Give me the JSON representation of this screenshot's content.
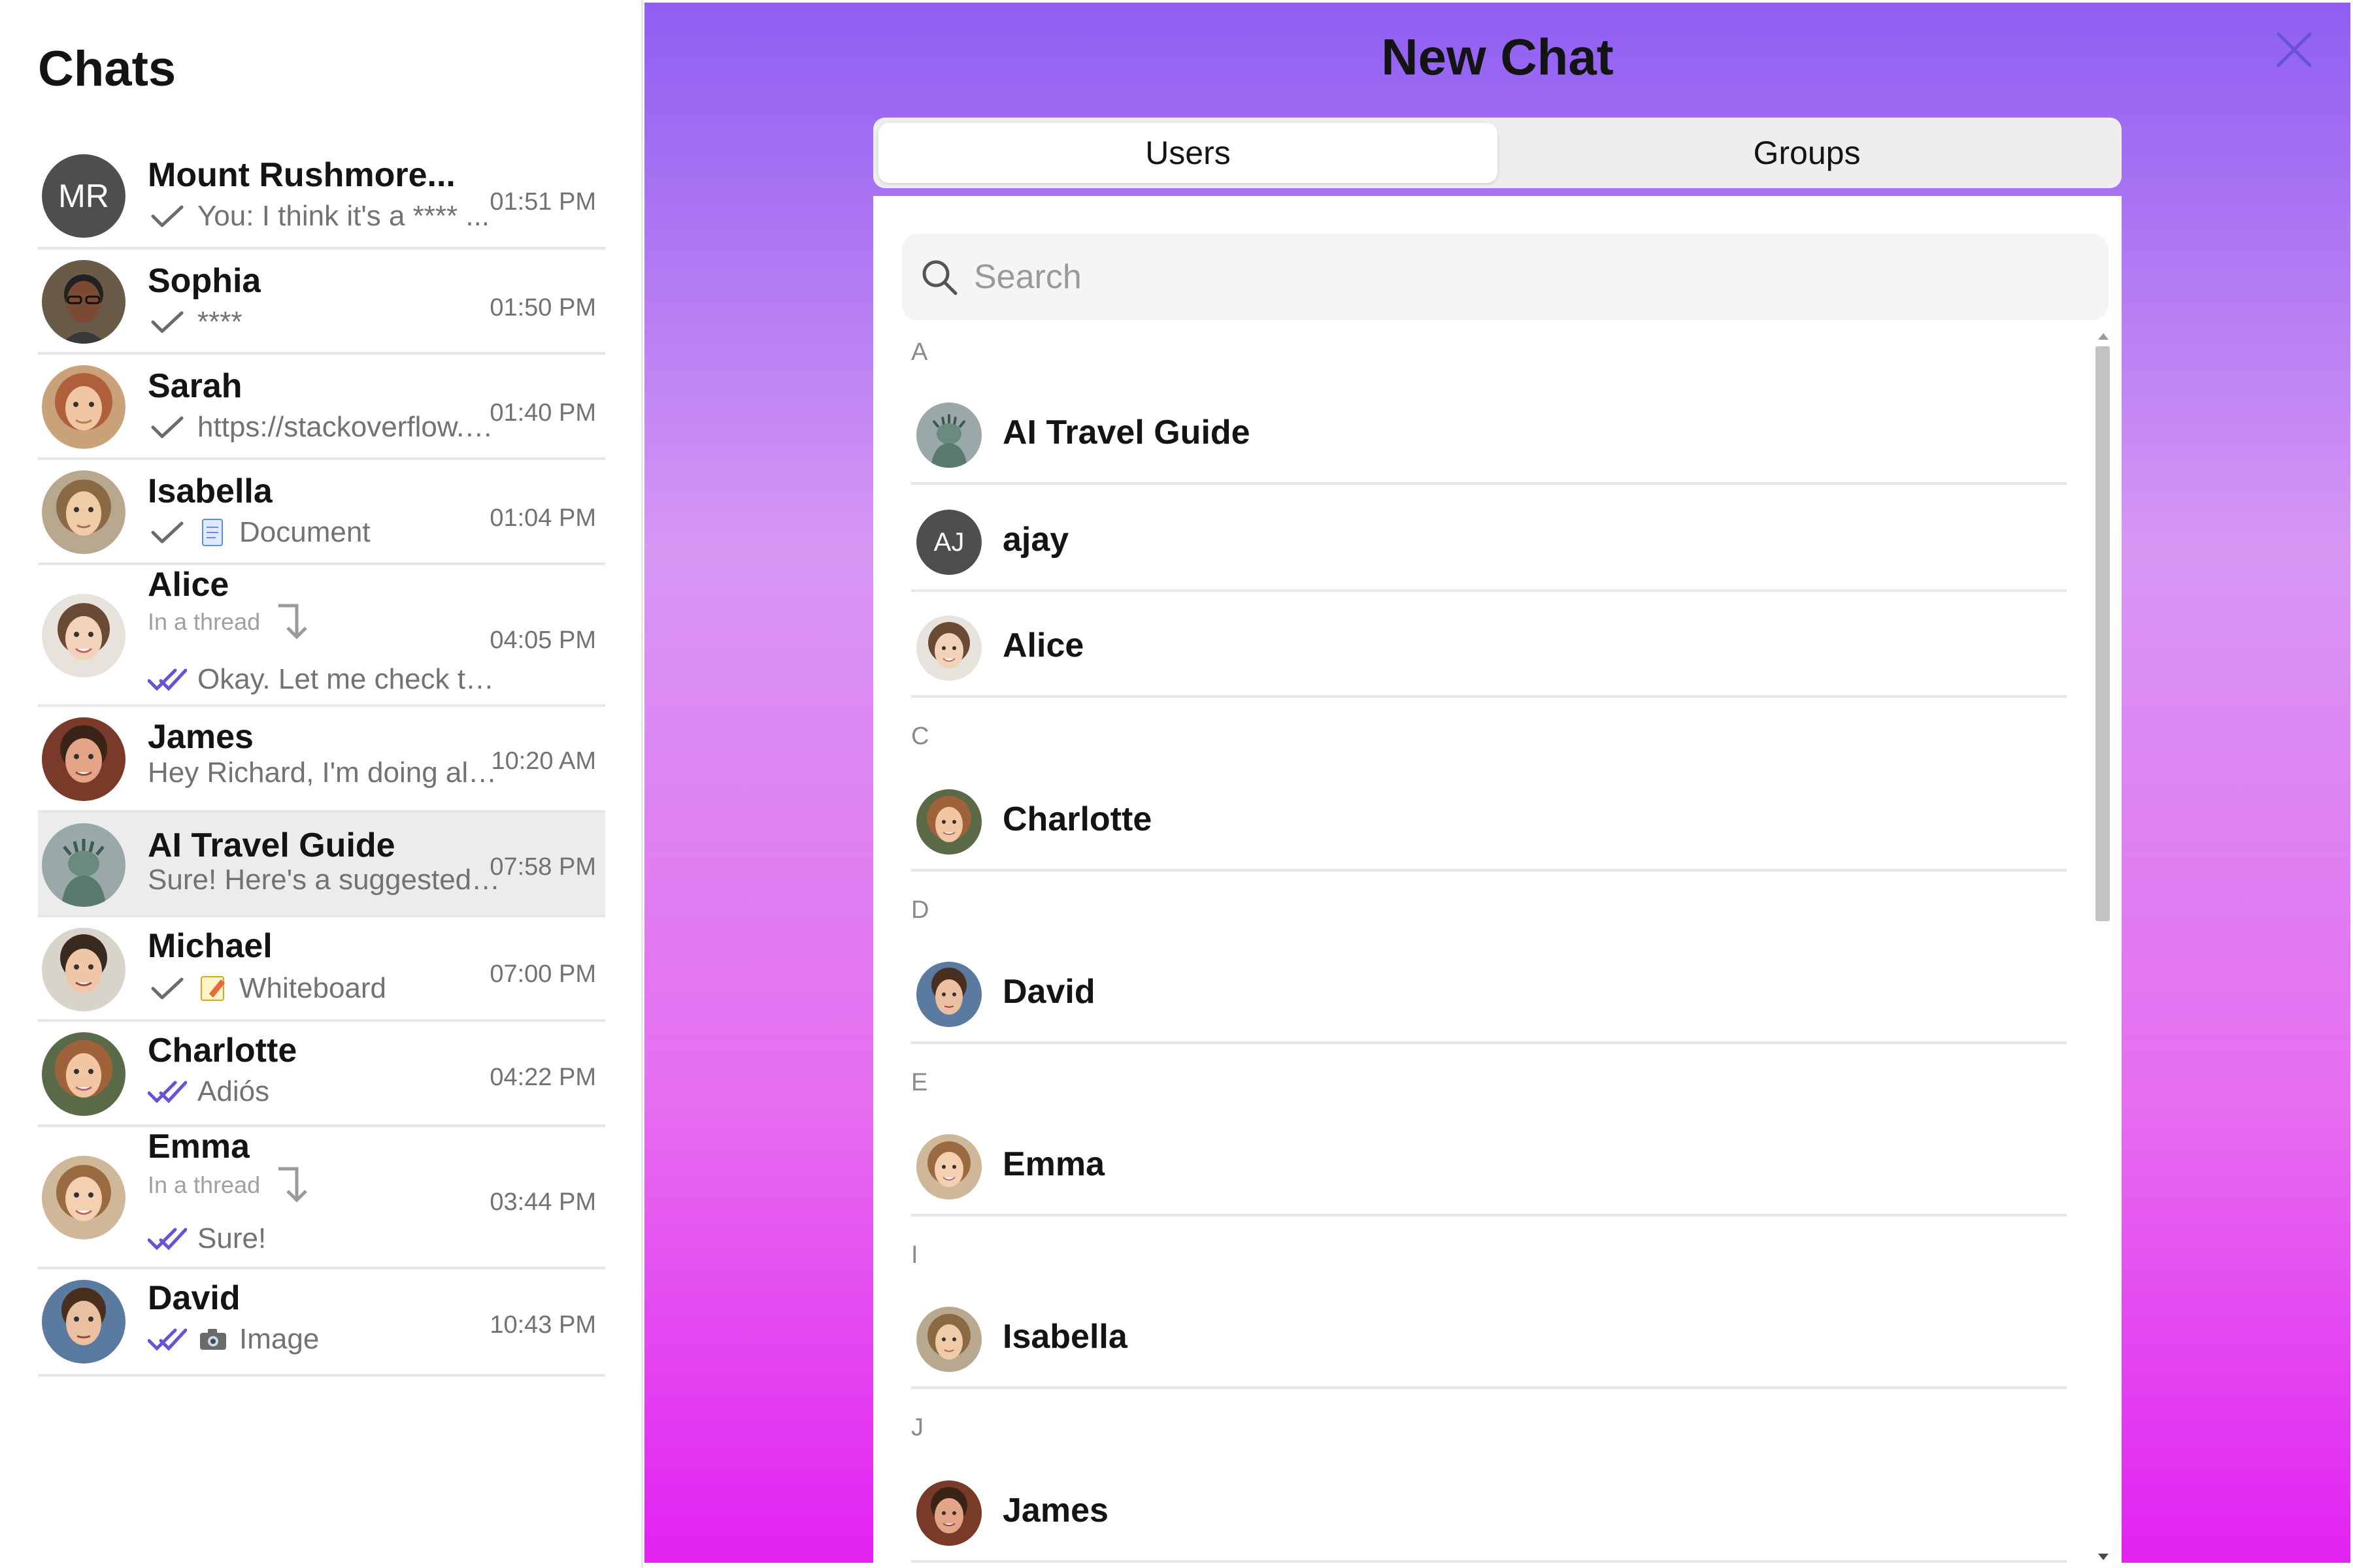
{
  "chats": {
    "title": "Chats",
    "items": [
      {
        "name": "Mount Rushmore...",
        "initials": "MR",
        "receipt": "sent",
        "preview": "You: I think it's a **** ...",
        "time": "01:51 PM"
      },
      {
        "name": "Sophia",
        "receipt": "sent",
        "preview": "****",
        "time": "01:50 PM"
      },
      {
        "name": "Sarah",
        "receipt": "sent",
        "preview": "https://stackoverflow.…",
        "time": "01:40 PM"
      },
      {
        "name": "Isabella",
        "receipt": "sent",
        "preview": "Document",
        "time": "01:04 PM"
      },
      {
        "name": "Alice",
        "thread_label": "In a thread",
        "receipt": "read",
        "preview": "Okay. Let me check t…",
        "time": "04:05 PM"
      },
      {
        "name": "James",
        "preview": "Hey Richard, I'm doing al…",
        "time": "10:20 AM"
      },
      {
        "name": "AI Travel Guide",
        "preview": "Sure! Here's a suggested…",
        "time": "07:58 PM"
      },
      {
        "name": "Michael",
        "receipt": "sent",
        "preview": "Whiteboard",
        "time": "07:00 PM"
      },
      {
        "name": "Charlotte",
        "receipt": "read",
        "preview": "Adiós",
        "time": "04:22 PM"
      },
      {
        "name": "Emma",
        "thread_label": "In a thread",
        "receipt": "read",
        "preview": "Sure!",
        "time": "03:44 PM"
      },
      {
        "name": "David",
        "receipt": "read",
        "preview": "Image",
        "time": "10:43 PM"
      }
    ]
  },
  "new_chat": {
    "title": "New Chat",
    "tabs": [
      {
        "label": "Users"
      },
      {
        "label": "Groups"
      }
    ],
    "search": {
      "placeholder": "Search"
    },
    "sections": [
      {
        "letter": "A",
        "users": [
          {
            "name": "AI Travel Guide"
          },
          {
            "name": "ajay",
            "initials": "AJ"
          },
          {
            "name": "Alice"
          }
        ]
      },
      {
        "letter": "C",
        "users": [
          {
            "name": "Charlotte"
          }
        ]
      },
      {
        "letter": "D",
        "users": [
          {
            "name": "David"
          }
        ]
      },
      {
        "letter": "E",
        "users": [
          {
            "name": "Emma"
          }
        ]
      },
      {
        "letter": "I",
        "users": [
          {
            "name": "Isabella"
          }
        ]
      },
      {
        "letter": "J",
        "users": [
          {
            "name": "James"
          }
        ]
      }
    ]
  },
  "colors": {
    "accent": "#6852d6",
    "gradient_top": "#8e5ff2",
    "gradient_bottom": "#e222f2",
    "close_icon": "#6852d6"
  }
}
